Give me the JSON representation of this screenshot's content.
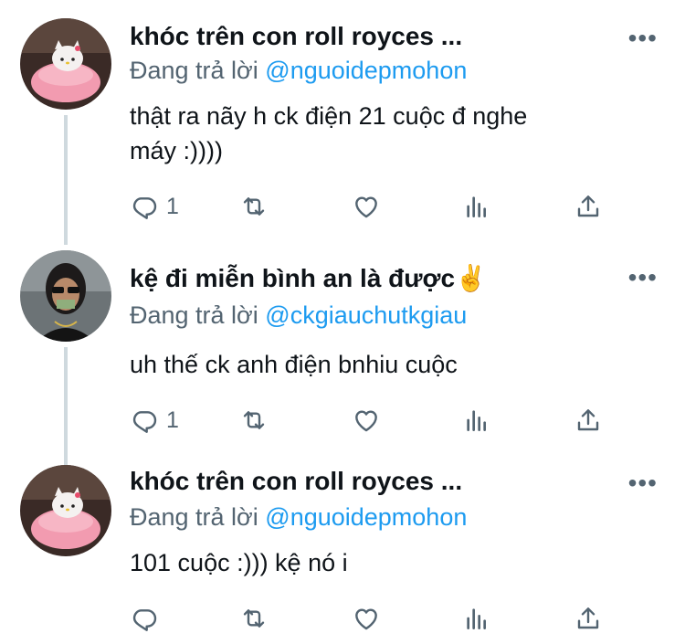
{
  "tweets": [
    {
      "name": "khóc trên con roll royces",
      "ellipsis": "...",
      "reply_prefix": "Đang trả lời",
      "reply_handle": "@nguoidepmohon",
      "text_lines": [
        "thật ra nãy h ck điện 21 cuộc đ nghe",
        "máy :))))"
      ],
      "reply_count": "1",
      "more": "•••"
    },
    {
      "name": "kệ đi miễn bình an là được✌️",
      "reply_prefix": "Đang trả lời",
      "reply_handle": "@ckgiauchutkgiau",
      "text_lines": [
        "uh thế ck anh điện bnhiu cuộc"
      ],
      "reply_count": "1",
      "more": "•••"
    },
    {
      "name": "khóc trên con roll royces",
      "ellipsis": "...",
      "reply_prefix": "Đang trả lời",
      "reply_handle": "@nguoidepmohon",
      "text_lines": [
        "101 cuộc :))) kệ nó i"
      ],
      "reply_count": "",
      "more": "•••"
    }
  ],
  "icons": [
    "reply-icon",
    "retweet-icon",
    "like-icon",
    "views-icon",
    "share-icon",
    "more-icon"
  ],
  "colors": {
    "text": "#0f1419",
    "muted": "#536471",
    "link": "#1d9bf0",
    "thread": "#cfd9de"
  }
}
